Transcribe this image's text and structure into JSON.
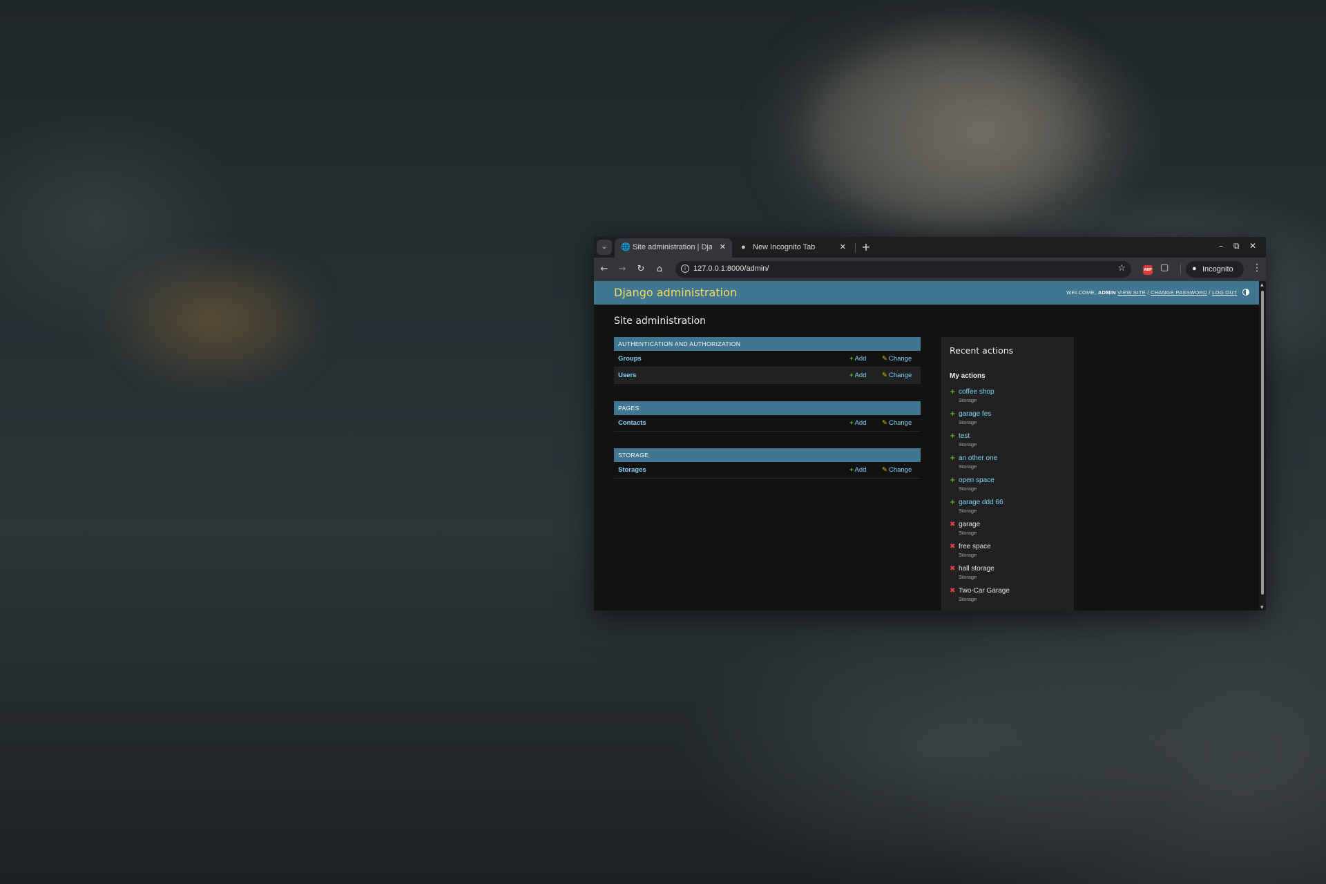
{
  "browser": {
    "tabs": [
      {
        "title": "Site administration | Djan",
        "active": true,
        "favicon": "globe-icon"
      },
      {
        "title": "New Incognito Tab",
        "active": false,
        "favicon": "incognito-icon"
      }
    ],
    "new_tab": "+",
    "url": "127.0.0.1:8000/admin/",
    "incognito_label": "Incognito",
    "abp_label": "ABP"
  },
  "admin": {
    "branding": "Django administration",
    "usertools": {
      "welcome": "WELCOME,",
      "username": "ADMIN",
      "view_site": "VIEW SITE",
      "sep1": "/",
      "change_password": "CHANGE PASSWORD",
      "sep2": "/",
      "log_out": "LOG OUT"
    },
    "page_title": "Site administration",
    "add_label": "Add",
    "change_label": "Change",
    "modules": [
      {
        "caption": "AUTHENTICATION AND AUTHORIZATION",
        "models": [
          "Groups",
          "Users"
        ]
      },
      {
        "caption": "PAGES",
        "models": [
          "Contacts"
        ]
      },
      {
        "caption": "STORAGE",
        "models": [
          "Storages"
        ]
      }
    ],
    "recent": {
      "title": "Recent actions",
      "subtitle": "My actions",
      "items": [
        {
          "name": "coffee shop",
          "type": "Storage",
          "action": "add"
        },
        {
          "name": "garage fes",
          "type": "Storage",
          "action": "add"
        },
        {
          "name": "test",
          "type": "Storage",
          "action": "add"
        },
        {
          "name": "an other one",
          "type": "Storage",
          "action": "add"
        },
        {
          "name": "open space",
          "type": "Storage",
          "action": "add"
        },
        {
          "name": "garage ddd 66",
          "type": "Storage",
          "action": "add"
        },
        {
          "name": "garage",
          "type": "Storage",
          "action": "delete"
        },
        {
          "name": "free space",
          "type": "Storage",
          "action": "delete"
        },
        {
          "name": "hall storage",
          "type": "Storage",
          "action": "delete"
        },
        {
          "name": "Two-Car Garage",
          "type": "Storage",
          "action": "delete"
        }
      ]
    }
  },
  "colors": {
    "header": "#417690",
    "branding": "#f5dd5d",
    "link": "#81d4fa",
    "add_icon": "#70bf2b",
    "delete_icon": "#e04343",
    "change_icon": "#efb80b"
  }
}
